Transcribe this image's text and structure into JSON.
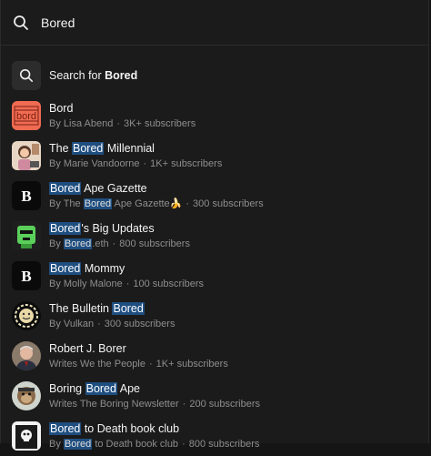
{
  "search": {
    "query": "Bored"
  },
  "search_for": {
    "prefix": "Search for ",
    "term": "Bored"
  },
  "results": [
    {
      "title": [
        {
          "t": "Bord"
        }
      ],
      "sub": [
        {
          "t": "By Lisa Abend"
        }
      ],
      "count": "3K+ subscribers",
      "avatar_text": "bord",
      "avatar_icon": "bord-logo-icon"
    },
    {
      "title": [
        {
          "t": "The "
        },
        {
          "t": "Bored",
          "hl": true
        },
        {
          "t": " Millennial"
        }
      ],
      "sub": [
        {
          "t": "By Marie Vandoorne"
        }
      ],
      "count": "1K+ subscribers",
      "avatar_icon": "illustrated-woman-avatar-icon"
    },
    {
      "title": [
        {
          "t": "Bored",
          "hl": true
        },
        {
          "t": " Ape Gazette"
        }
      ],
      "sub": [
        {
          "t": "By The "
        },
        {
          "t": "Bored",
          "hl": true
        },
        {
          "t": " Ape Gazette🍌"
        }
      ],
      "count": "300 subscribers",
      "avatar_text": "B",
      "avatar_icon": "bold-b-logo-icon"
    },
    {
      "title": [
        {
          "t": "Bored",
          "hl": true
        },
        {
          "t": "'s Big Updates"
        }
      ],
      "sub": [
        {
          "t": "By "
        },
        {
          "t": "Bored",
          "hl": true
        },
        {
          "t": ".eth"
        }
      ],
      "count": "800 subscribers",
      "avatar_icon": "green-robot-avatar-icon"
    },
    {
      "title": [
        {
          "t": "Bored",
          "hl": true
        },
        {
          "t": " Mommy"
        }
      ],
      "sub": [
        {
          "t": "By Molly Malone"
        }
      ],
      "count": "100 subscribers",
      "avatar_text": "B",
      "avatar_icon": "bold-b-logo-icon"
    },
    {
      "title": [
        {
          "t": "The Bulletin "
        },
        {
          "t": "Bored",
          "hl": true
        }
      ],
      "sub": [
        {
          "t": "By Vulkan"
        }
      ],
      "count": "300 subscribers",
      "avatar_icon": "sun-face-avatar-icon"
    },
    {
      "title": [
        {
          "t": "Robert J. Borer"
        }
      ],
      "sub": [
        {
          "t": "Writes We the People"
        }
      ],
      "count": "1K+ subscribers",
      "avatar_icon": "man-portrait-avatar-icon"
    },
    {
      "title": [
        {
          "t": "Boring "
        },
        {
          "t": "Bored",
          "hl": true
        },
        {
          "t": " Ape"
        }
      ],
      "sub": [
        {
          "t": "Writes The Boring Newsletter"
        }
      ],
      "count": "200 subscribers",
      "avatar_icon": "ape-avatar-icon"
    },
    {
      "title": [
        {
          "t": "Bored",
          "hl": true
        },
        {
          "t": " to Death book club"
        }
      ],
      "sub": [
        {
          "t": "By "
        },
        {
          "t": "Bored",
          "hl": true
        },
        {
          "t": " to Death book club"
        }
      ],
      "count": "800 subscribers",
      "avatar_icon": "skull-book-avatar-icon"
    }
  ],
  "separator": "·",
  "colors": {
    "background": "#1b1b1b",
    "highlight": "#1f4e80",
    "muted": "#8e8e8e"
  }
}
